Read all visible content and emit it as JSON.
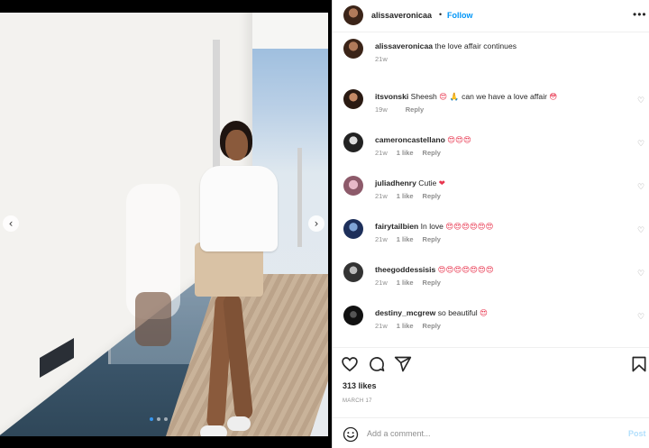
{
  "header": {
    "username": "alissaveronicaa",
    "separator": "•",
    "follow_label": "Follow",
    "more_icon": "more-options-icon"
  },
  "carousel": {
    "prev_icon": "chevron-left-icon",
    "next_icon": "chevron-right-icon",
    "dot_count": 3,
    "active_dot": 0
  },
  "caption": {
    "username": "alissaveronicaa",
    "text": "the love affair continues",
    "time": "21w"
  },
  "comments": [
    {
      "username": "itsvonski",
      "text": "Sheesh",
      "emoji": "😍 🙏 ",
      "text2": "can we have a love affair",
      "emoji2": "😳",
      "time": "19w",
      "likes": "",
      "reply": "Reply"
    },
    {
      "username": "cameroncastellano",
      "text": "",
      "emoji": "😍😍😍",
      "text2": "",
      "emoji2": "",
      "time": "21w",
      "likes": "1 like",
      "reply": "Reply"
    },
    {
      "username": "juliadhenry",
      "text": "Cutie",
      "emoji": "❤",
      "text2": "",
      "emoji2": "",
      "time": "21w",
      "likes": "1 like",
      "reply": "Reply"
    },
    {
      "username": "fairytailbien",
      "text": "In love",
      "emoji": "😍😍😍😍😍😍",
      "text2": "",
      "emoji2": "",
      "time": "21w",
      "likes": "1 like",
      "reply": "Reply"
    },
    {
      "username": "theegoddessisis",
      "text": "",
      "emoji": "😍😍😍😍😍😍😍",
      "text2": "",
      "emoji2": "",
      "time": "21w",
      "likes": "1 like",
      "reply": "Reply"
    },
    {
      "username": "destiny_mcgrew",
      "text": "so beautiful",
      "emoji": "😍",
      "text2": "",
      "emoji2": "",
      "time": "21w",
      "likes": "1 like",
      "reply": "Reply"
    }
  ],
  "actions": {
    "like_icon": "heart-icon",
    "comment_icon": "comment-icon",
    "share_icon": "share-icon",
    "save_icon": "bookmark-icon"
  },
  "likes_label": "313 likes",
  "date_label": "MARCH 17",
  "add_comment": {
    "placeholder": "Add a comment...",
    "post_label": "Post",
    "emoji_icon": "emoji-icon"
  },
  "colors": {
    "accent": "#0095f6",
    "post_disabled": "#b2dffc",
    "meta_gray": "#8e8e8e",
    "heart_emoji": "#e8364f"
  }
}
